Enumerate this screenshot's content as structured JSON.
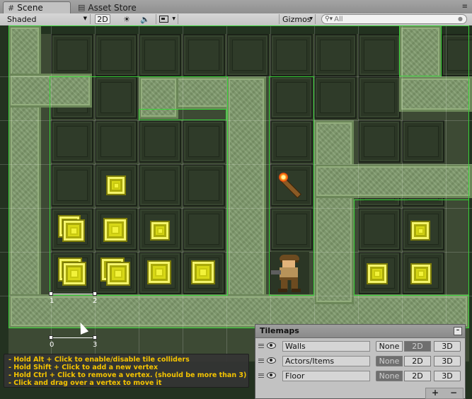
{
  "tabs": [
    {
      "label": "Scene",
      "icon": "grid-icon"
    },
    {
      "label": "Asset Store",
      "icon": "store-icon"
    }
  ],
  "toolbar": {
    "shading": "Shaded",
    "mode_2d": "2D",
    "gizmos": "Gizmos",
    "search_placeholder": "All"
  },
  "vertices": [
    {
      "label": "1"
    },
    {
      "label": "2"
    },
    {
      "label": "0"
    },
    {
      "label": "3"
    }
  ],
  "help": {
    "lines": [
      "- Hold Alt + Click to enable/disable tile colliders",
      "- Hold Shift + Click to add a new vertex",
      "- Hold Ctrl + Click to remove a vertex. (should be more than 3)",
      "- Click and drag over a vertex to move it"
    ]
  },
  "tilemaps": {
    "title": "Tilemaps",
    "options": [
      "None",
      "2D",
      "3D"
    ],
    "layers": [
      {
        "name": "Walls",
        "selected": "2D"
      },
      {
        "name": "Actors/Items",
        "selected": "None"
      },
      {
        "name": "Floor",
        "selected": "None"
      }
    ],
    "add_label": "+",
    "remove_label": "−"
  },
  "colors": {
    "accent_help_text": "#f5c400",
    "collider_outline": "#39d539",
    "coin": "#d8d816"
  }
}
